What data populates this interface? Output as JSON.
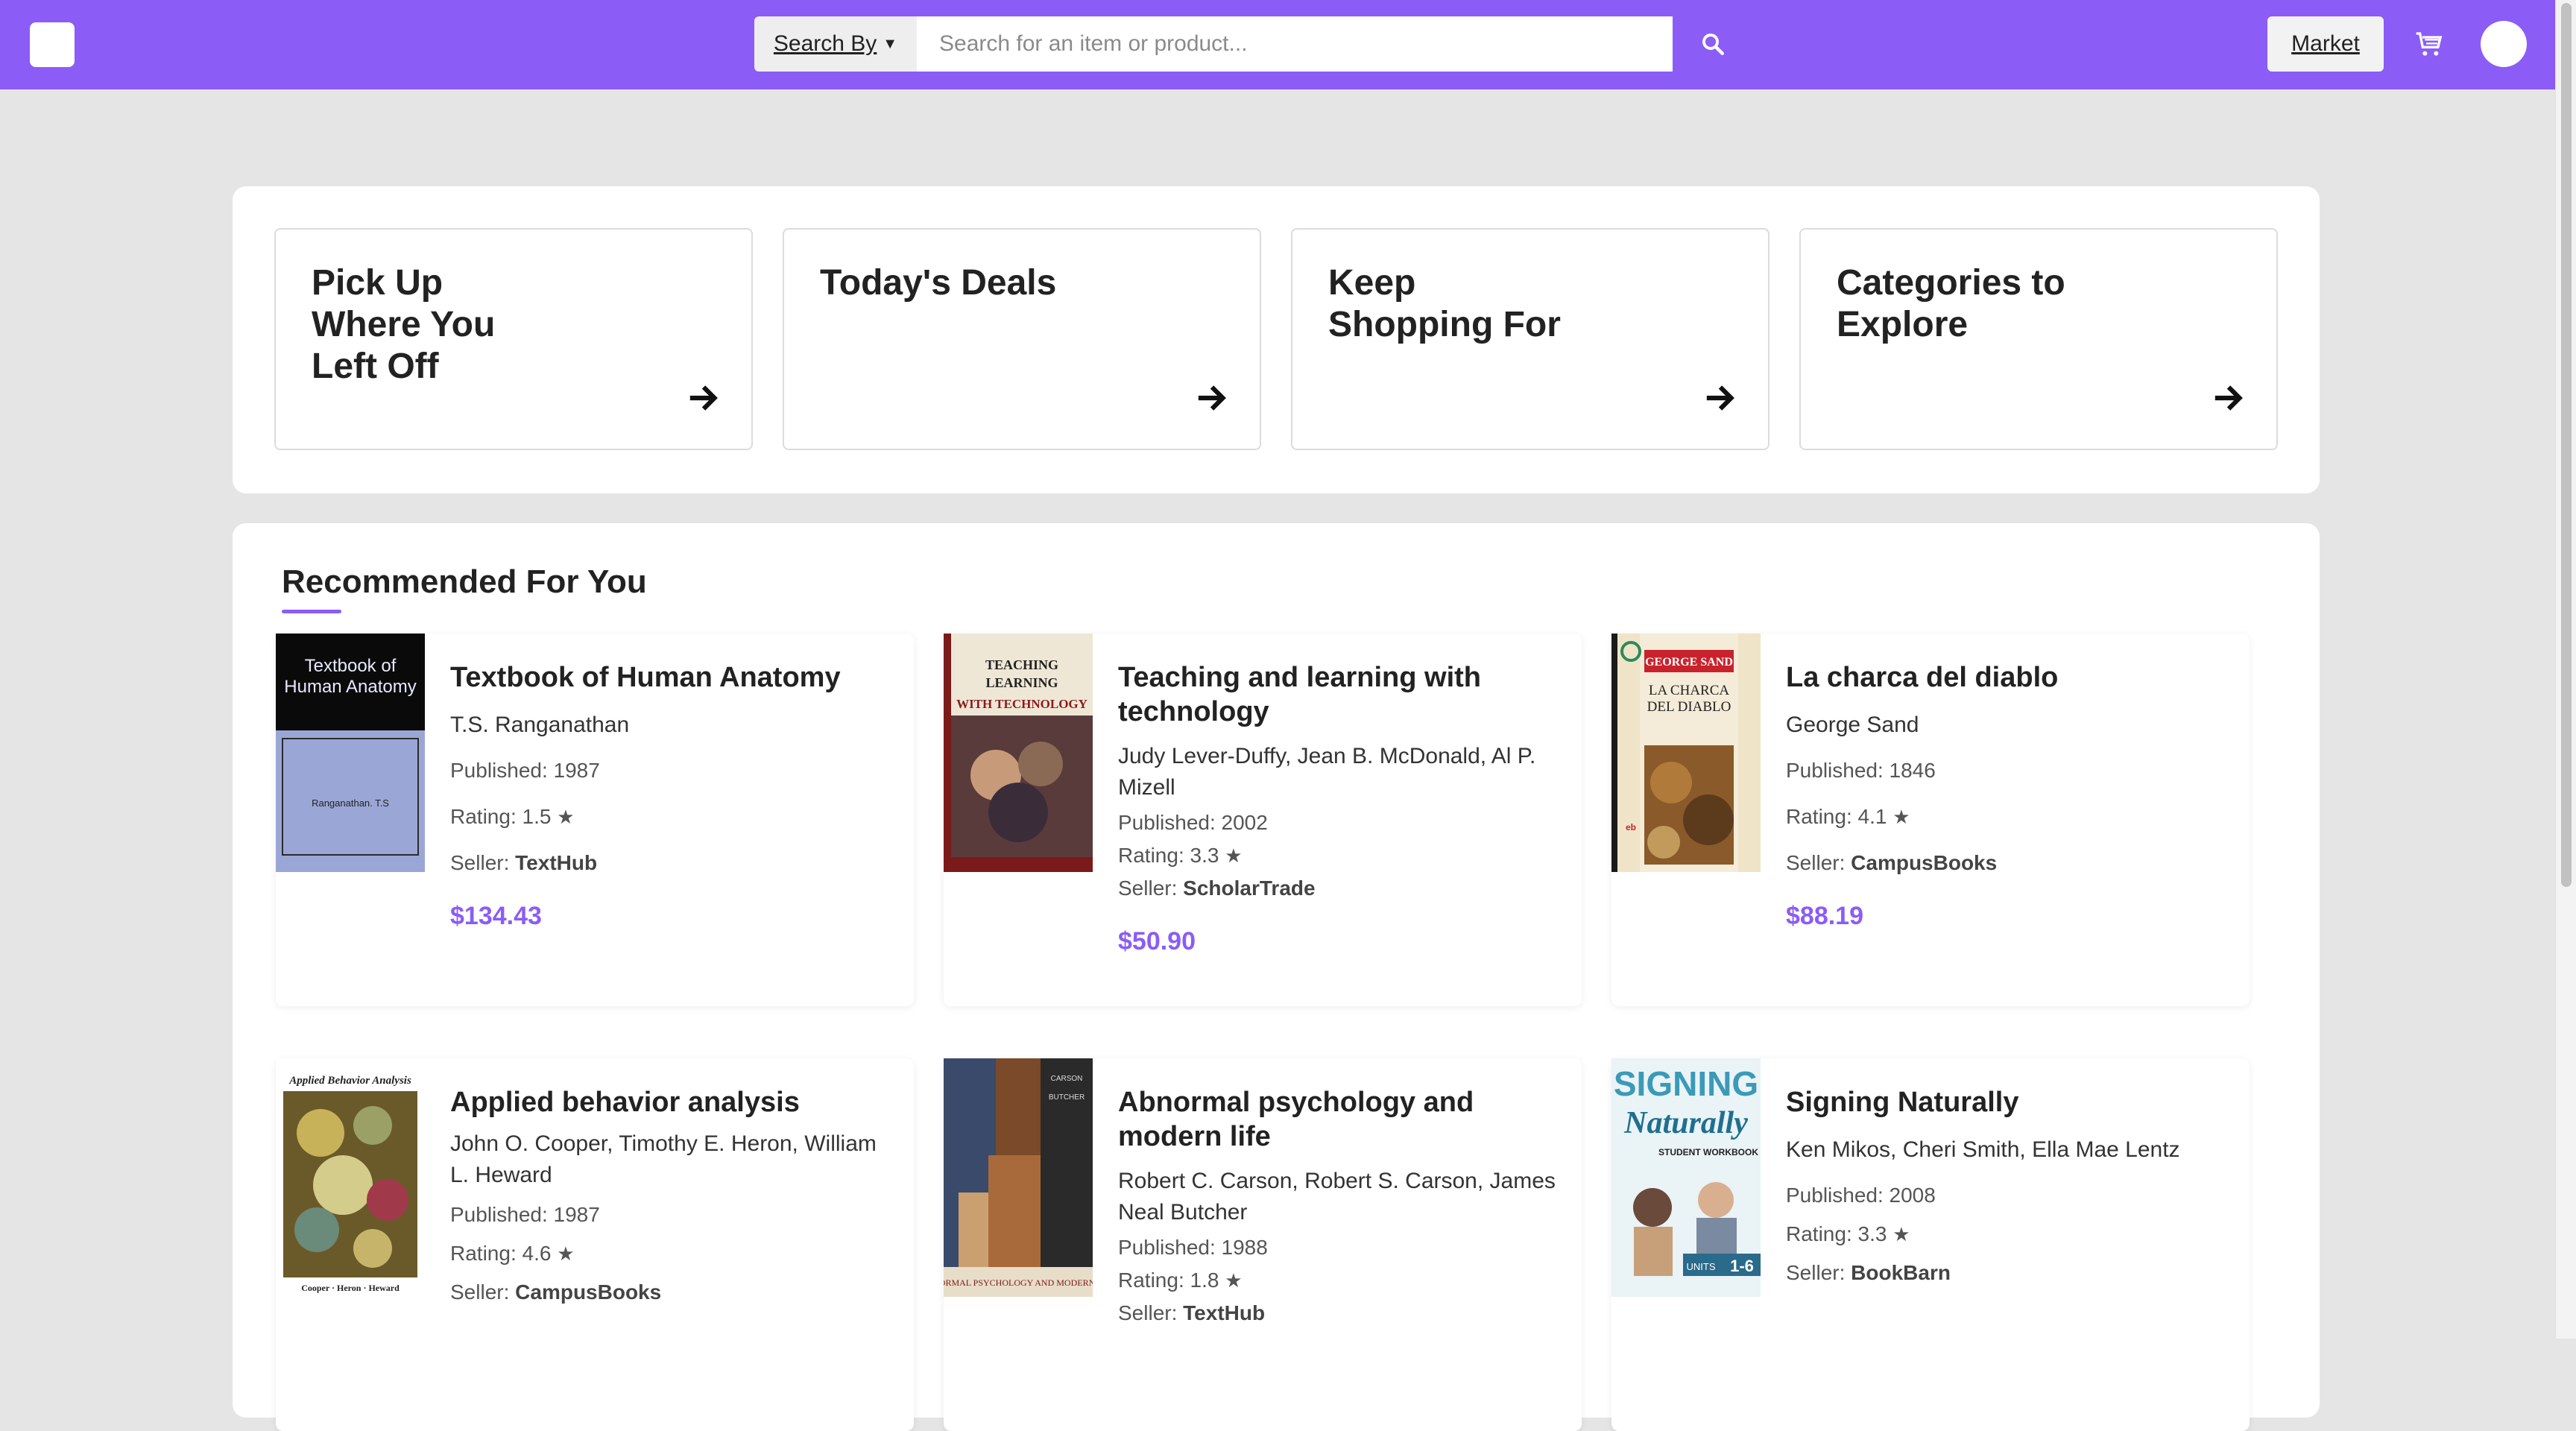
{
  "header": {
    "search_by_label": "Search By",
    "search_placeholder": "Search for an item or product...",
    "search_value": "",
    "market_label": "Market"
  },
  "colors": {
    "brand": "#8b5cf6",
    "background": "#e5e5e5",
    "price": "#8b5cf6"
  },
  "quick_links": [
    {
      "label": "Pick Up Where You Left Off",
      "icon": "arrow-right-icon"
    },
    {
      "label": "Today's Deals",
      "icon": "arrow-right-icon"
    },
    {
      "label": "Keep Shopping For",
      "icon": "arrow-right-icon"
    },
    {
      "label": "Categories to Explore",
      "icon": "arrow-right-icon"
    }
  ],
  "recommended": {
    "title": "Recommended For You",
    "books": [
      {
        "title": "Textbook of Human Anatomy",
        "authors": "T.S. Ranganathan",
        "published_label": "Published: 1987",
        "rating_label": "Rating: 1.5",
        "seller_prefix": "Seller:",
        "seller": "TextHub",
        "price": "$134.43",
        "cover_title": "Textbook of Human Anatomy",
        "cover_author": "Ranganathan. T.S"
      },
      {
        "title": "Teaching and learning with technology",
        "authors": "Judy Lever-Duffy, Jean B. McDonald, Al P. Mizell",
        "published_label": "Published: 2002",
        "rating_label": "Rating: 3.3",
        "seller_prefix": "Seller:",
        "seller": "ScholarTrade",
        "price": "$50.90",
        "cover_title": "TEACHING LEARNING WITH TECHNOLOGY"
      },
      {
        "title": "La charca del diablo",
        "authors": "George Sand",
        "published_label": "Published: 1846",
        "rating_label": "Rating: 4.1",
        "seller_prefix": "Seller:",
        "seller": "CampusBooks",
        "price": "$88.19",
        "cover_title": "LA CHARCA DEL DIABLO",
        "cover_author": "GEORGE SAND"
      },
      {
        "title": "Applied behavior analysis",
        "authors": "John O. Cooper, Timothy E. Heron, William L. Heward",
        "published_label": "Published: 1987",
        "rating_label": "Rating: 4.6",
        "seller_prefix": "Seller:",
        "seller": "CampusBooks",
        "cover_title": "Applied Behavior Analysis",
        "cover_author": "Cooper · Heron · Heward"
      },
      {
        "title": "Abnormal psychology and modern life",
        "authors": "Robert C. Carson, Robert S. Carson, James Neal Butcher",
        "published_label": "Published: 1988",
        "rating_label": "Rating: 1.8",
        "seller_prefix": "Seller:",
        "seller": "TextHub",
        "cover_title": "ABNORMAL PSYCHOLOGY AND MODERN LIFE"
      },
      {
        "title": "Signing Naturally",
        "authors": "Ken Mikos, Cheri Smith, Ella Mae Lentz",
        "published_label": "Published: 2008",
        "rating_label": "Rating: 3.3",
        "seller_prefix": "Seller:",
        "seller": "BookBarn",
        "cover_title": "SIGNING Naturally",
        "cover_subtitle": "STUDENT WORKBOOK",
        "cover_units": "UNITS 1-6"
      }
    ]
  }
}
